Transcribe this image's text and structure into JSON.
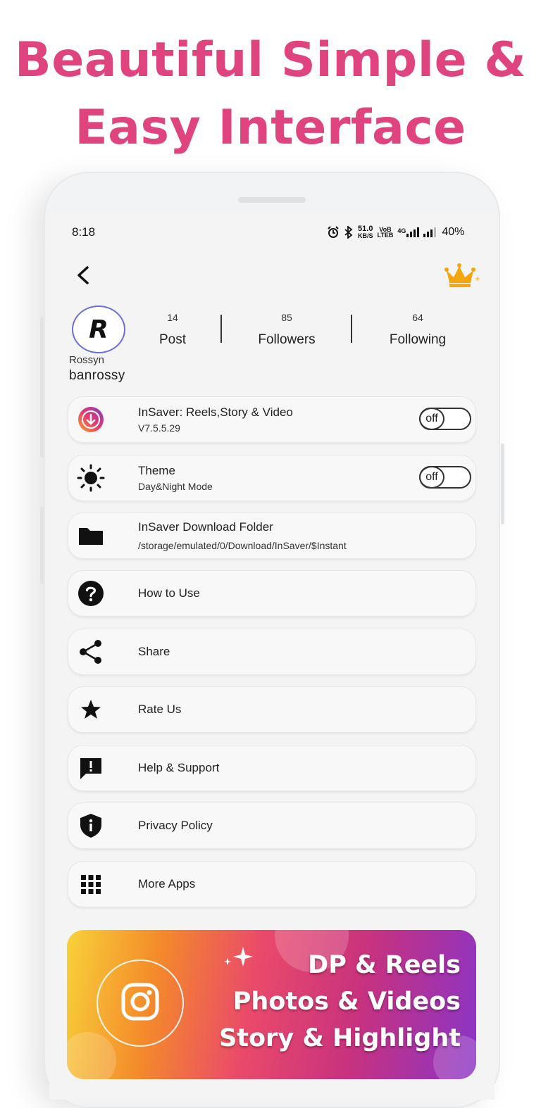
{
  "headline": {
    "line1": "Beautiful Simple &",
    "line2": "Easy Interface"
  },
  "status_bar": {
    "time": "8:18",
    "net_speed": "51.0",
    "net_unit": "KB/S",
    "volte_top": "VoB",
    "volte_bottom": "LTEB",
    "net_type": "4G",
    "battery": "40%"
  },
  "profile": {
    "display_name": "Rossyn",
    "username": "banrossy",
    "avatar_letter": "R",
    "stats": [
      {
        "count": "14",
        "label": "Post"
      },
      {
        "count": "85",
        "label": "Followers"
      },
      {
        "count": "64",
        "label": "Following"
      }
    ]
  },
  "settings": {
    "app": {
      "title": "InSaver: Reels,Story & Video",
      "subtitle": "V7.5.5.29",
      "toggle": "off"
    },
    "theme": {
      "title": "Theme",
      "subtitle": "Day&Night Mode",
      "toggle": "off"
    },
    "folder": {
      "title": "InSaver Download Folder",
      "subtitle": "/storage/emulated/0/Download/InSaver/$Instant"
    },
    "how_to_use": "How to Use",
    "share": "Share",
    "rate_us": "Rate Us",
    "help_support": "Help & Support",
    "privacy_policy": "Privacy Policy",
    "more_apps": "More Apps"
  },
  "banner": {
    "line1": "DP & Reels",
    "line2": "Photos & Videos",
    "line3": "Story & Highlight"
  },
  "colors": {
    "headline": "#e0447f",
    "crown": "#f4a60c",
    "banner_start": "#f8d23a",
    "banner_end": "#8a34c8"
  },
  "icons": [
    "back-arrow-icon",
    "crown-icon",
    "download-icon",
    "sun-icon",
    "folder-icon",
    "help-circle-icon",
    "share-icon",
    "star-icon",
    "feedback-icon",
    "shield-info-icon",
    "grid-icon",
    "instagram-icon",
    "sparkle-icon"
  ]
}
